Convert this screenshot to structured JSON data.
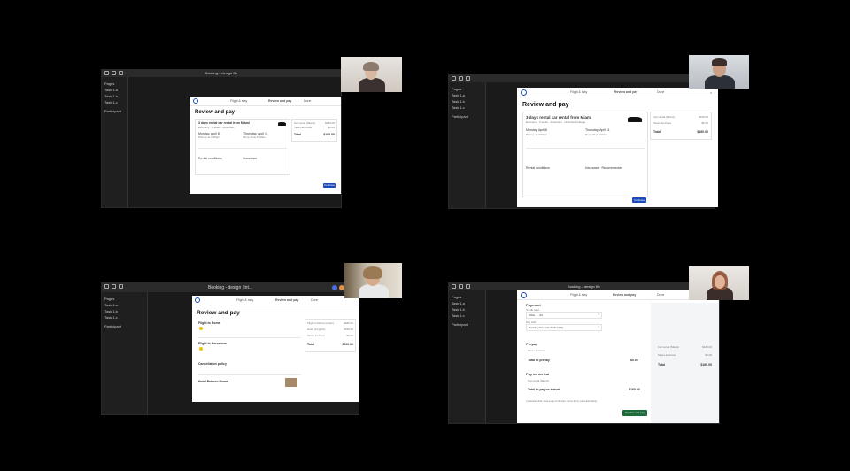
{
  "tiles": [
    {
      "window_title": "Booking – design file",
      "pages_label": "Pages",
      "pages": [
        "Task 1.a",
        "Task 1.b",
        "Task 1.c"
      ],
      "notes_label": "Participant",
      "nav": [
        "Flight & stay",
        "Review and pay",
        "Done"
      ],
      "heading": "Review and pay",
      "trip_title": "3 days rental car rental from Miami",
      "trip_sub": "Economy · 5 seats · Automatic",
      "pickup_label": "Monday, April 8",
      "dropoff_label": "Thursday, April 11",
      "pickup_time": "Pick up at 3:00pm",
      "dropoff_time": "Drop off at 9:00am",
      "price_rows": [
        {
          "label": "Car rental (Miami)",
          "value": "$160.00"
        },
        {
          "label": "Taxes and fees",
          "value": "$0.00"
        }
      ],
      "total_label": "Total",
      "total_value": "$160.00",
      "section1": "Rental conditions",
      "section2": "Insurance",
      "cta": "Continue"
    },
    {
      "window_title": "Booking – design file",
      "pages_label": "Pages",
      "pages": [
        "Task 1.a",
        "Task 1.b",
        "Task 1.c"
      ],
      "notes_label": "Participant",
      "nav": [
        "Flight & stay",
        "Review and pay",
        "Done"
      ],
      "heading": "Review and pay",
      "trip_title": "3 days rental car rental from Miami",
      "trip_sub": "Economy · 5 seats · Automatic · Unlimited mileage",
      "pickup_label": "Monday, April 8",
      "dropoff_label": "Thursday, April 11",
      "pickup_time": "Pick up at 3:00pm",
      "dropoff_time": "Drop off at 9:00am",
      "price_rows": [
        {
          "label": "Car rental (Miami)",
          "value": "$160.00"
        },
        {
          "label": "Taxes and fees",
          "value": "$0.00"
        }
      ],
      "total_label": "Total",
      "total_value": "$160.00",
      "section1": "Rental conditions",
      "section2": "Insurance · Recommended",
      "cta": "Continue"
    },
    {
      "window_title": "Booking - design (Int...",
      "pages_label": "Pages",
      "pages": [
        "Task 1.a",
        "Task 1.b",
        "Task 1.c"
      ],
      "notes_label": "Participant",
      "nav": [
        "Flight & stay",
        "Review and pay",
        "Done"
      ],
      "heading": "Review and pay",
      "flight_out": "Flight to Rome",
      "flight_back": "Flight to Barcelona",
      "policy": "Cancellation policy",
      "hotel": "Hotel Palazzo Roma",
      "price_rows": [
        {
          "label": "Flight to Rome (return)",
          "value": "$480.00"
        },
        {
          "label": "Hotel (3 nights)",
          "value": "$330.00"
        },
        {
          "label": "Taxes and fees",
          "value": "$0.00"
        }
      ],
      "total_label": "Total",
      "total_value": "€900.00"
    },
    {
      "window_title": "Booking – design file",
      "pages_label": "Pages",
      "pages": [
        "Task 1.a",
        "Task 1.b",
        "Task 1.c"
      ],
      "notes_label": "Participant",
      "nav": [
        "Flight & stay",
        "Review and pay",
        "Done"
      ],
      "payment": "Payment",
      "card_label": "Credit card",
      "card_value": "VISA ···· 04",
      "wallet_label": "Pay with",
      "wallet_value": "Booking Rewards Wallet (€0)",
      "prepay": "Prepay",
      "prepay_row": "Taxes and fees",
      "total_prepay": "Total to prepay",
      "total_prepay_value": "$0.00",
      "arrival": "Pay on arrival",
      "arrival_row": "Car rental (Miami)",
      "total_arrival": "Total to pay on arrival",
      "total_arrival_value": "$160.00",
      "terms": "I understand that I need to pay in full when I arrive for my car rental booking.",
      "price_rows": [
        {
          "label": "Car rental (Miami)",
          "value": "$160.00"
        },
        {
          "label": "Taxes and fees",
          "value": "$0.00"
        }
      ],
      "total_label": "Total",
      "total_value": "$160.00",
      "cta": "Confirm and pay"
    }
  ]
}
